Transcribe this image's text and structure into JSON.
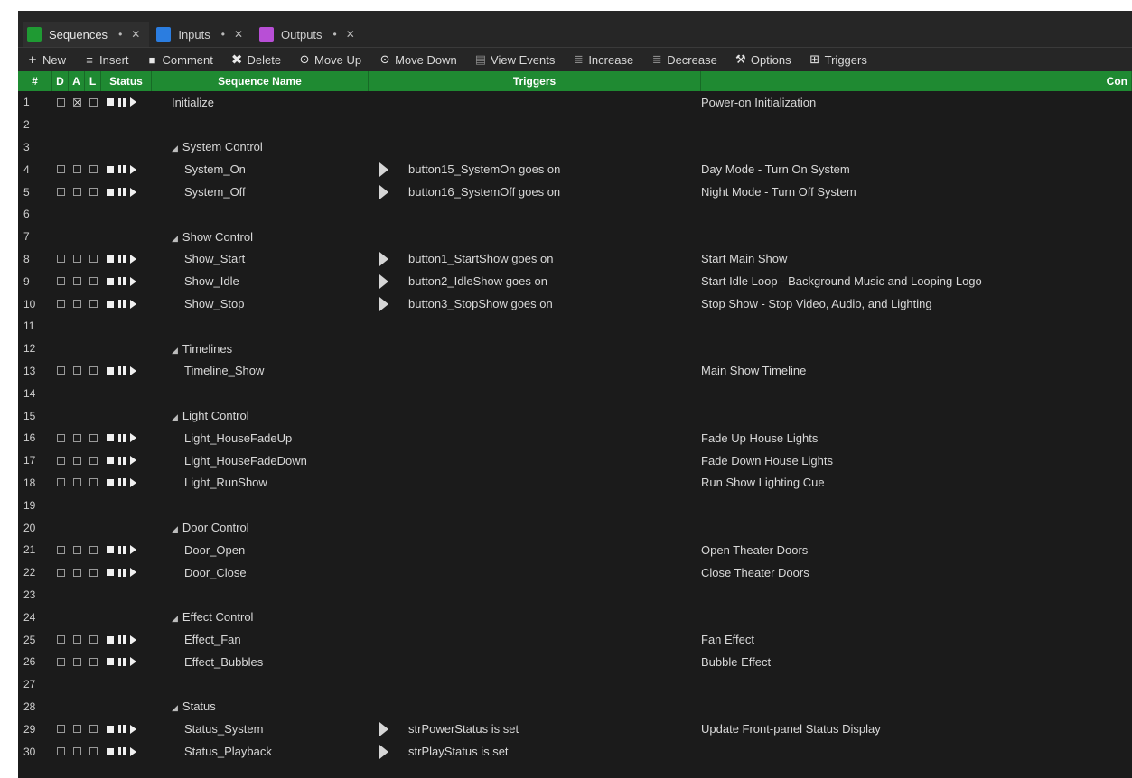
{
  "tabs": [
    {
      "label": "Sequences",
      "color": "#1f9a33",
      "active": true
    },
    {
      "label": "Inputs",
      "color": "#2b7de0",
      "active": false
    },
    {
      "label": "Outputs",
      "color": "#b84fd6",
      "active": false
    }
  ],
  "toolbar": {
    "new": "New",
    "insert": "Insert",
    "comment": "Comment",
    "delete": "Delete",
    "move_up": "Move Up",
    "move_down": "Move Down",
    "view_events": "View Events",
    "increase": "Increase",
    "decrease": "Decrease",
    "options": "Options",
    "triggers": "Triggers"
  },
  "columns": {
    "num": "#",
    "d": "D",
    "a": "A",
    "l": "L",
    "status": "Status",
    "name": "Sequence Name",
    "triggers": "Triggers",
    "comment": "Con"
  },
  "rows": [
    {
      "n": "1",
      "type": "seq",
      "name": "Initialize",
      "trigger": "",
      "comment": "Power-on Initialization",
      "a_checked": true,
      "indent": false
    },
    {
      "n": "2",
      "type": "blank"
    },
    {
      "n": "3",
      "type": "group",
      "name": "System Control"
    },
    {
      "n": "4",
      "type": "seq",
      "name": "System_On",
      "trigger": "button15_SystemOn goes on",
      "comment": "Day Mode - Turn On System",
      "indent": true
    },
    {
      "n": "5",
      "type": "seq",
      "name": "System_Off",
      "trigger": "button16_SystemOff goes on",
      "comment": "Night Mode - Turn Off System",
      "indent": true
    },
    {
      "n": "6",
      "type": "blank"
    },
    {
      "n": "7",
      "type": "group",
      "name": "Show Control"
    },
    {
      "n": "8",
      "type": "seq",
      "name": "Show_Start",
      "trigger": "button1_StartShow goes on",
      "comment": "Start Main Show",
      "indent": true
    },
    {
      "n": "9",
      "type": "seq",
      "name": "Show_Idle",
      "trigger": "button2_IdleShow goes on",
      "comment": "Start Idle Loop - Background Music and Looping Logo",
      "indent": true
    },
    {
      "n": "10",
      "type": "seq",
      "name": "Show_Stop",
      "trigger": "button3_StopShow goes on",
      "comment": "Stop Show - Stop Video, Audio, and Lighting",
      "indent": true
    },
    {
      "n": "11",
      "type": "blank"
    },
    {
      "n": "12",
      "type": "group",
      "name": "Timelines"
    },
    {
      "n": "13",
      "type": "seq",
      "name": "Timeline_Show",
      "trigger": "",
      "comment": "Main Show Timeline",
      "indent": true
    },
    {
      "n": "14",
      "type": "blank"
    },
    {
      "n": "15",
      "type": "group",
      "name": "Light Control"
    },
    {
      "n": "16",
      "type": "seq",
      "name": "Light_HouseFadeUp",
      "trigger": "",
      "comment": "Fade Up House Lights",
      "indent": true
    },
    {
      "n": "17",
      "type": "seq",
      "name": "Light_HouseFadeDown",
      "trigger": "",
      "comment": "Fade Down House Lights",
      "indent": true
    },
    {
      "n": "18",
      "type": "seq",
      "name": "Light_RunShow",
      "trigger": "",
      "comment": "Run Show Lighting Cue",
      "indent": true
    },
    {
      "n": "19",
      "type": "blank"
    },
    {
      "n": "20",
      "type": "group",
      "name": "Door Control"
    },
    {
      "n": "21",
      "type": "seq",
      "name": "Door_Open",
      "trigger": "",
      "comment": "Open Theater Doors",
      "indent": true
    },
    {
      "n": "22",
      "type": "seq",
      "name": "Door_Close",
      "trigger": "",
      "comment": "Close Theater Doors",
      "indent": true
    },
    {
      "n": "23",
      "type": "blank"
    },
    {
      "n": "24",
      "type": "group",
      "name": "Effect Control"
    },
    {
      "n": "25",
      "type": "seq",
      "name": "Effect_Fan",
      "trigger": "",
      "comment": "Fan Effect",
      "indent": true
    },
    {
      "n": "26",
      "type": "seq",
      "name": "Effect_Bubbles",
      "trigger": "",
      "comment": "Bubble Effect",
      "indent": true
    },
    {
      "n": "27",
      "type": "blank"
    },
    {
      "n": "28",
      "type": "group",
      "name": "Status"
    },
    {
      "n": "29",
      "type": "seq",
      "name": "Status_System",
      "trigger": "strPowerStatus is set",
      "comment": "Update Front-panel Status Display",
      "indent": true
    },
    {
      "n": "30",
      "type": "seq",
      "name": "Status_Playback",
      "trigger": "strPlayStatus is set",
      "comment": "",
      "indent": true
    }
  ],
  "colors": {
    "header_green": "#1f8a32",
    "background": "#1b1b1b",
    "text": "#d8d8d8"
  }
}
